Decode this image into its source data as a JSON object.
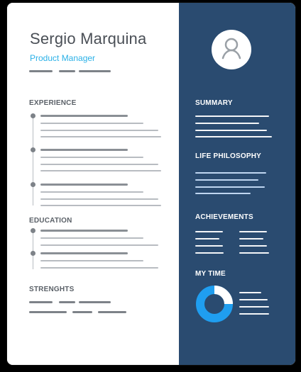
{
  "left": {
    "name": "Sergio Marquina",
    "role": "Product Manager",
    "sections": {
      "experience": "EXPERIENCE",
      "education": "EDUCATION",
      "strengths": "STRENGHTS"
    }
  },
  "right": {
    "sections": {
      "summary": "SUMMARY",
      "life_philosophy": "LIFE PHILOSOPHY",
      "achievements": "ACHIEVEMENTS",
      "my_time": "MY TIME"
    },
    "colors": {
      "panel": "#2a4b70",
      "accent": "#1f9ef0",
      "white": "#ffffff"
    }
  }
}
